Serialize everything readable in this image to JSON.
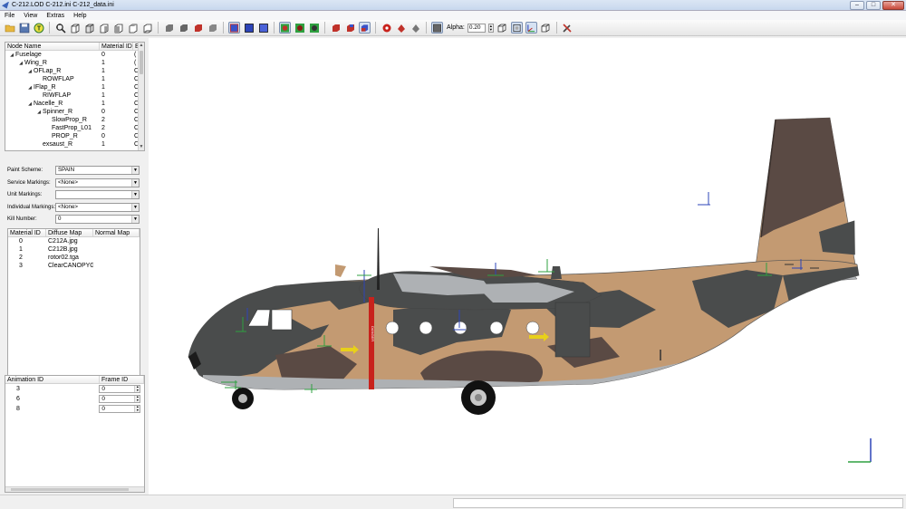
{
  "window": {
    "title": "C-212.LOD  C-212.ini  C-212_data.ini",
    "minimize": "–",
    "maximize": "□",
    "close": "✕"
  },
  "menu": [
    "File",
    "View",
    "Extras",
    "Help"
  ],
  "toolbar": {
    "icons": [
      "open-folder-icon",
      "save-icon",
      "texture-t-icon",
      "zoom-icon",
      "view-front-icon",
      "view-back-icon",
      "view-left-icon",
      "view-right-icon",
      "view-top-icon",
      "view-bottom-icon",
      "solid-gray-icon",
      "solid-gray-icon",
      "solid-red-icon",
      "solid-gray-icon",
      "wireframe-blue-icon",
      "wireframe-blue-icon",
      "wireframe-blue-icon",
      "sphere-green-icon",
      "sphere-green-icon",
      "sphere-green-icon",
      "cube-red-icon",
      "cube-red-icon",
      "cube-blue-icon",
      "gear-red-icon",
      "lamp-red-icon",
      "lamp-gray-icon",
      "lamp-gray-icon",
      "box-shade-icon"
    ],
    "alpha_label": "Alpha:",
    "alpha_value": "0.20"
  },
  "node_tree": {
    "headers": [
      "Node Name",
      "Material ID",
      "E"
    ],
    "rows": [
      {
        "name": "Fuselage",
        "material": "0",
        "extra": "(",
        "indent": 0,
        "expander": "◢"
      },
      {
        "name": "Wing_R",
        "material": "1",
        "extra": "(",
        "indent": 1,
        "expander": "◢"
      },
      {
        "name": "OFLap_R",
        "material": "1",
        "extra": "C",
        "indent": 2,
        "expander": "◢"
      },
      {
        "name": "ROWFLAP",
        "material": "1",
        "extra": "C",
        "indent": 3,
        "expander": ""
      },
      {
        "name": "IFlap_R",
        "material": "1",
        "extra": "C",
        "indent": 2,
        "expander": "◢"
      },
      {
        "name": "RIWFLAP",
        "material": "1",
        "extra": "C",
        "indent": 3,
        "expander": ""
      },
      {
        "name": "Nacelle_R",
        "material": "1",
        "extra": "C",
        "indent": 2,
        "expander": "◢"
      },
      {
        "name": "Spinner_R",
        "material": "0",
        "extra": "C",
        "indent": 3,
        "expander": "◢"
      },
      {
        "name": "SlowProp_R",
        "material": "2",
        "extra": "C",
        "indent": 4,
        "expander": ""
      },
      {
        "name": "FastProp_L01",
        "material": "2",
        "extra": "C",
        "indent": 4,
        "expander": ""
      },
      {
        "name": "PROP_R",
        "material": "0",
        "extra": "C",
        "indent": 4,
        "expander": ""
      },
      {
        "name": "exsaust_R",
        "material": "1",
        "extra": "C",
        "indent": 3,
        "expander": ""
      }
    ]
  },
  "markings": {
    "paint_scheme": {
      "label": "Paint Scheme:",
      "value": "SPAIN"
    },
    "service": {
      "label": "Service Markings:",
      "value": "<None>"
    },
    "unit": {
      "label": "Unit Markings:",
      "value": ""
    },
    "individual": {
      "label": "Individual Markings:",
      "value": "<None>"
    },
    "kill": {
      "label": "Kill Number:",
      "value": "0"
    }
  },
  "materials": {
    "headers": [
      "Material ID",
      "Diffuse Map",
      "Normal Map"
    ],
    "rows": [
      {
        "id": "0",
        "diffuse": "C212A.jpg",
        "normal": ""
      },
      {
        "id": "1",
        "diffuse": "C212B.jpg",
        "normal": ""
      },
      {
        "id": "2",
        "diffuse": "rotor02.tga",
        "normal": ""
      },
      {
        "id": "3",
        "diffuse": "ClearCANOPYG...",
        "normal": ""
      }
    ]
  },
  "animations": {
    "headers": [
      "Animation ID",
      "Frame ID"
    ],
    "rows": [
      {
        "id": "3",
        "frame": "0"
      },
      {
        "id": "6",
        "frame": "0"
      },
      {
        "id": "8",
        "frame": "0"
      }
    ]
  },
  "model": {
    "danger_text": "DANGER",
    "colors": {
      "tan": "#c39a72",
      "dark_gray": "#4a4c4c",
      "brown": "#5a4a44",
      "light_gray": "#aeb1b4",
      "red": "#c8221c",
      "yellow": "#e8d01a"
    }
  }
}
